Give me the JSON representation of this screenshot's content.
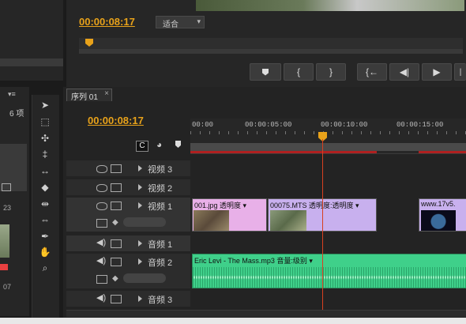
{
  "source_monitor": {
    "timecode": "00:00:08:17",
    "fit_select": "适合"
  },
  "transport": {
    "buttons": [
      "marker-icon",
      "mark-in-icon",
      "mark-out-icon",
      "go-to-in-icon",
      "step-back-icon",
      "play-icon",
      "step-forward-icon"
    ]
  },
  "project_panel": {
    "count_label": "6 项",
    "timecode_frag": "23",
    "timecode_frag2": "07"
  },
  "sequence": {
    "tab_label": "序列 01",
    "close": "×",
    "timecode": "00:00:08:17",
    "ruler_labels": [
      "00:00",
      "00:00:05:00",
      "00:00:10:00",
      "00:00:15:00"
    ]
  },
  "tracks": [
    {
      "name": "视频 3",
      "kind": "video"
    },
    {
      "name": "视频 2",
      "kind": "video"
    },
    {
      "name": "视频 1",
      "kind": "video"
    },
    {
      "name": "音频 1",
      "kind": "audio"
    },
    {
      "name": "音频 2",
      "kind": "audio"
    },
    {
      "name": "音频 3",
      "kind": "audio"
    }
  ],
  "clips": {
    "v1a": "001.jpg  透明度 ▾",
    "v1b": "00075.MTS  透明度:透明度 ▾",
    "v1c": "www.17v5.",
    "a2": "Eric Levi - The Mass.mp3  音量:级别 ▾"
  },
  "colors": {
    "timecode": "#e8a21a",
    "video_clip": "#c8a8ee",
    "audio_clip": "#3fd08a",
    "playhead": "#d84020"
  }
}
